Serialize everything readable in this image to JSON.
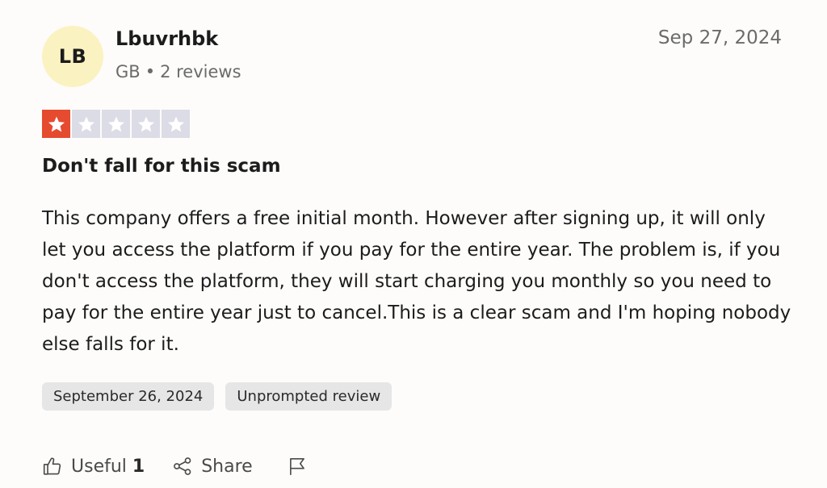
{
  "reviewer": {
    "initials": "LB",
    "name": "Lbuvrhbk",
    "country": "GB",
    "separator": "•",
    "reviews_count": "2 reviews",
    "avatar_color": "#fbf2c2"
  },
  "review": {
    "posted_date": "Sep 27, 2024",
    "rating": 1,
    "rating_max": 5,
    "star_filled_color": "#e54b2e",
    "star_empty_color": "#dcdce6",
    "title": "Don't fall for this scam",
    "body": "This company offers a free initial month. However after signing up, it will only let you access the platform if you pay for the entire year. The problem is, if you don't access the platform, they will start charging you monthly so you need to pay for the entire year just to cancel.This is a clear scam and I'm hoping nobody else falls for it.",
    "experience_date": "September 26, 2024",
    "review_type": "Unprompted review"
  },
  "actions": {
    "useful_label": "Useful",
    "useful_count": "1",
    "useful_icon": "thumbs-up-icon",
    "share_label": "Share",
    "share_icon": "share-icon",
    "report_icon": "flag-icon"
  }
}
